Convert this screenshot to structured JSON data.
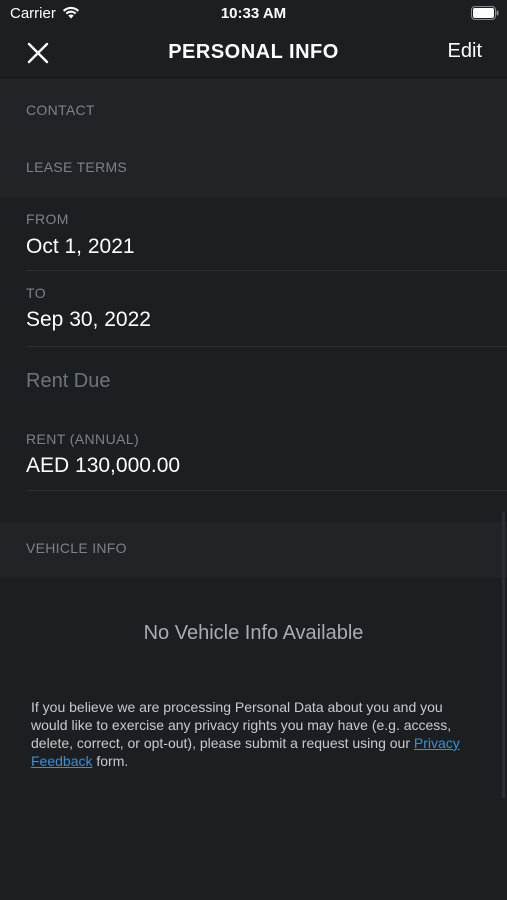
{
  "status_bar": {
    "carrier": "Carrier",
    "time": "10:33 AM"
  },
  "nav": {
    "title": "PERSONAL INFO",
    "edit_label": "Edit"
  },
  "sections": {
    "contact": "CONTACT",
    "lease_terms": "LEASE TERMS",
    "vehicle_info": "VEHICLE INFO"
  },
  "lease": {
    "from_label": "FROM",
    "from_value": "Oct 1, 2021",
    "to_label": "TO",
    "to_value": "Sep 30, 2022",
    "rent_due_label": "Rent Due",
    "rent_label": "RENT (ANNUAL)",
    "rent_value": "AED 130,000.00"
  },
  "vehicle": {
    "empty_message": "No Vehicle Info Available"
  },
  "privacy": {
    "text_before": "If you believe we are processing Personal Data about you and you would like to exercise any privacy rights you may have (e.g. access, delete, correct, or opt-out), please submit a request using our ",
    "link_text": "Privacy Feedback",
    "text_after": " form."
  },
  "colors": {
    "background": "#1c1f22",
    "section_background": "#202427",
    "label": "#7c8287",
    "link": "#3a8fd6"
  }
}
